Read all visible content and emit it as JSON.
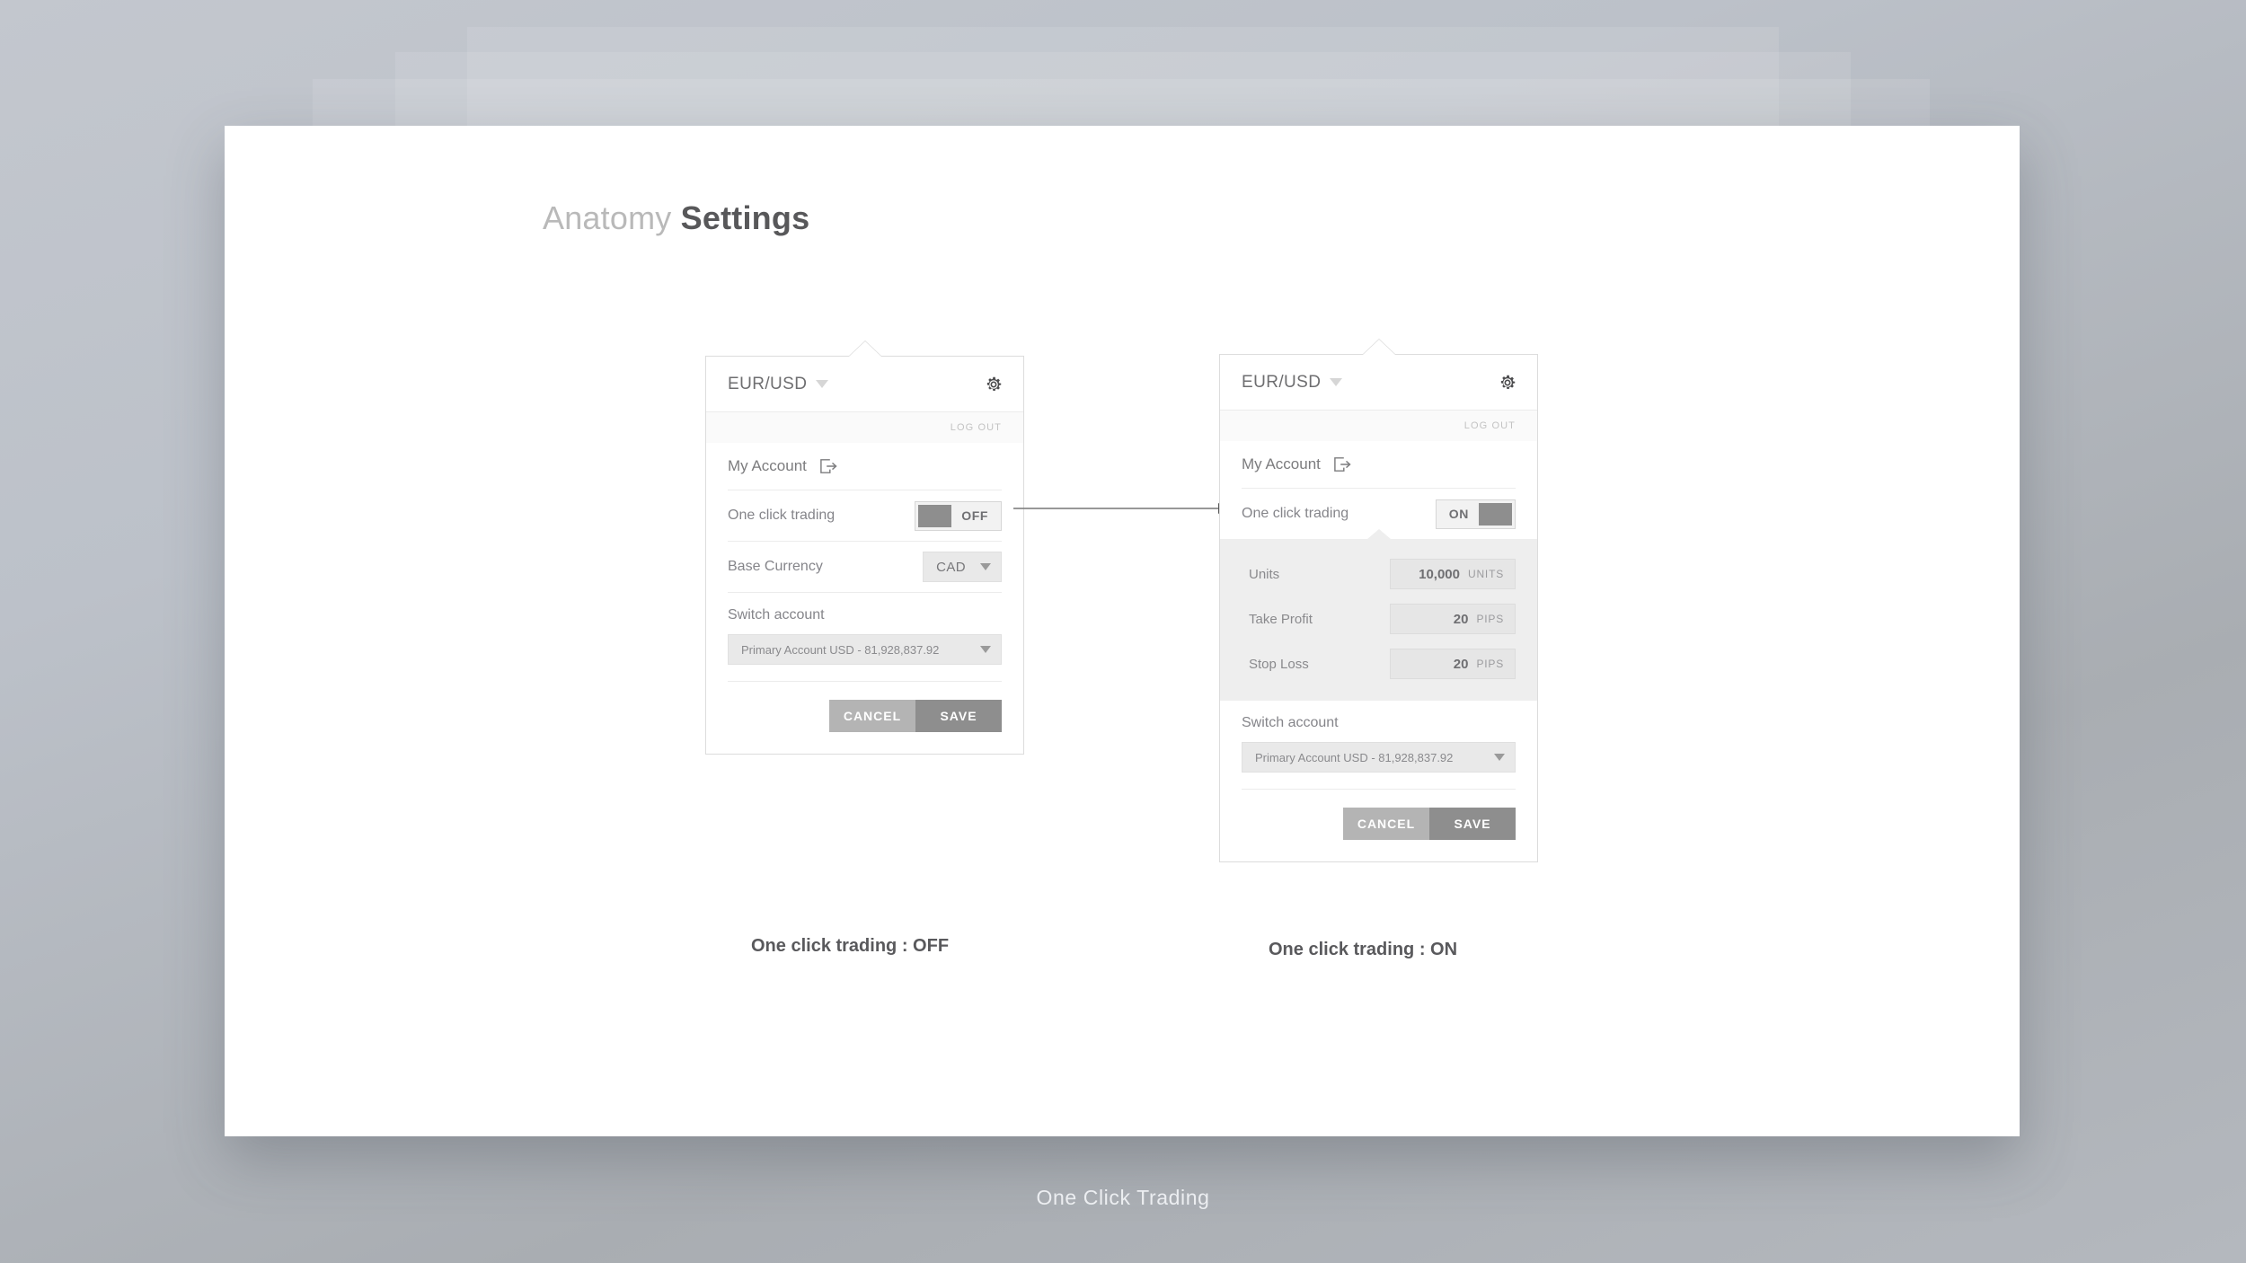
{
  "page": {
    "title_thin": "Anatomy",
    "title_bold": "Settings",
    "footer": "One Click Trading"
  },
  "captions": {
    "left": "One click trading : OFF",
    "right": "One click trading : ON"
  },
  "panel_left": {
    "pair": "EUR/USD",
    "logout": "LOG OUT",
    "my_account": "My Account",
    "rows": {
      "one_click_label": "One click trading",
      "one_click_state": "OFF",
      "base_currency_label": "Base Currency",
      "base_currency_value": "CAD"
    },
    "switch_account_label": "Switch account",
    "account_value": "Primary Account USD - 81,928,837.92",
    "buttons": {
      "cancel": "CANCEL",
      "save": "SAVE"
    }
  },
  "panel_right": {
    "pair": "EUR/USD",
    "logout": "LOG OUT",
    "my_account": "My Account",
    "rows": {
      "one_click_label": "One click trading",
      "one_click_state": "ON"
    },
    "one_click_settings": [
      {
        "label": "Units",
        "value": "10,000",
        "unit": "UNITS"
      },
      {
        "label": "Take Profit",
        "value": "20",
        "unit": "PIPS"
      },
      {
        "label": "Stop Loss",
        "value": "20",
        "unit": "PIPS"
      }
    ],
    "switch_account_label": "Switch account",
    "account_value": "Primary Account USD - 81,928,837.92",
    "buttons": {
      "cancel": "CANCEL",
      "save": "SAVE"
    }
  },
  "colors": {
    "toggle_knob": "#8e8e8e",
    "save_button": "#8e8e8e",
    "cancel_button": "#b4b4b4",
    "group_background": "#eeeeee",
    "panel_border": "#dcdcdc"
  }
}
